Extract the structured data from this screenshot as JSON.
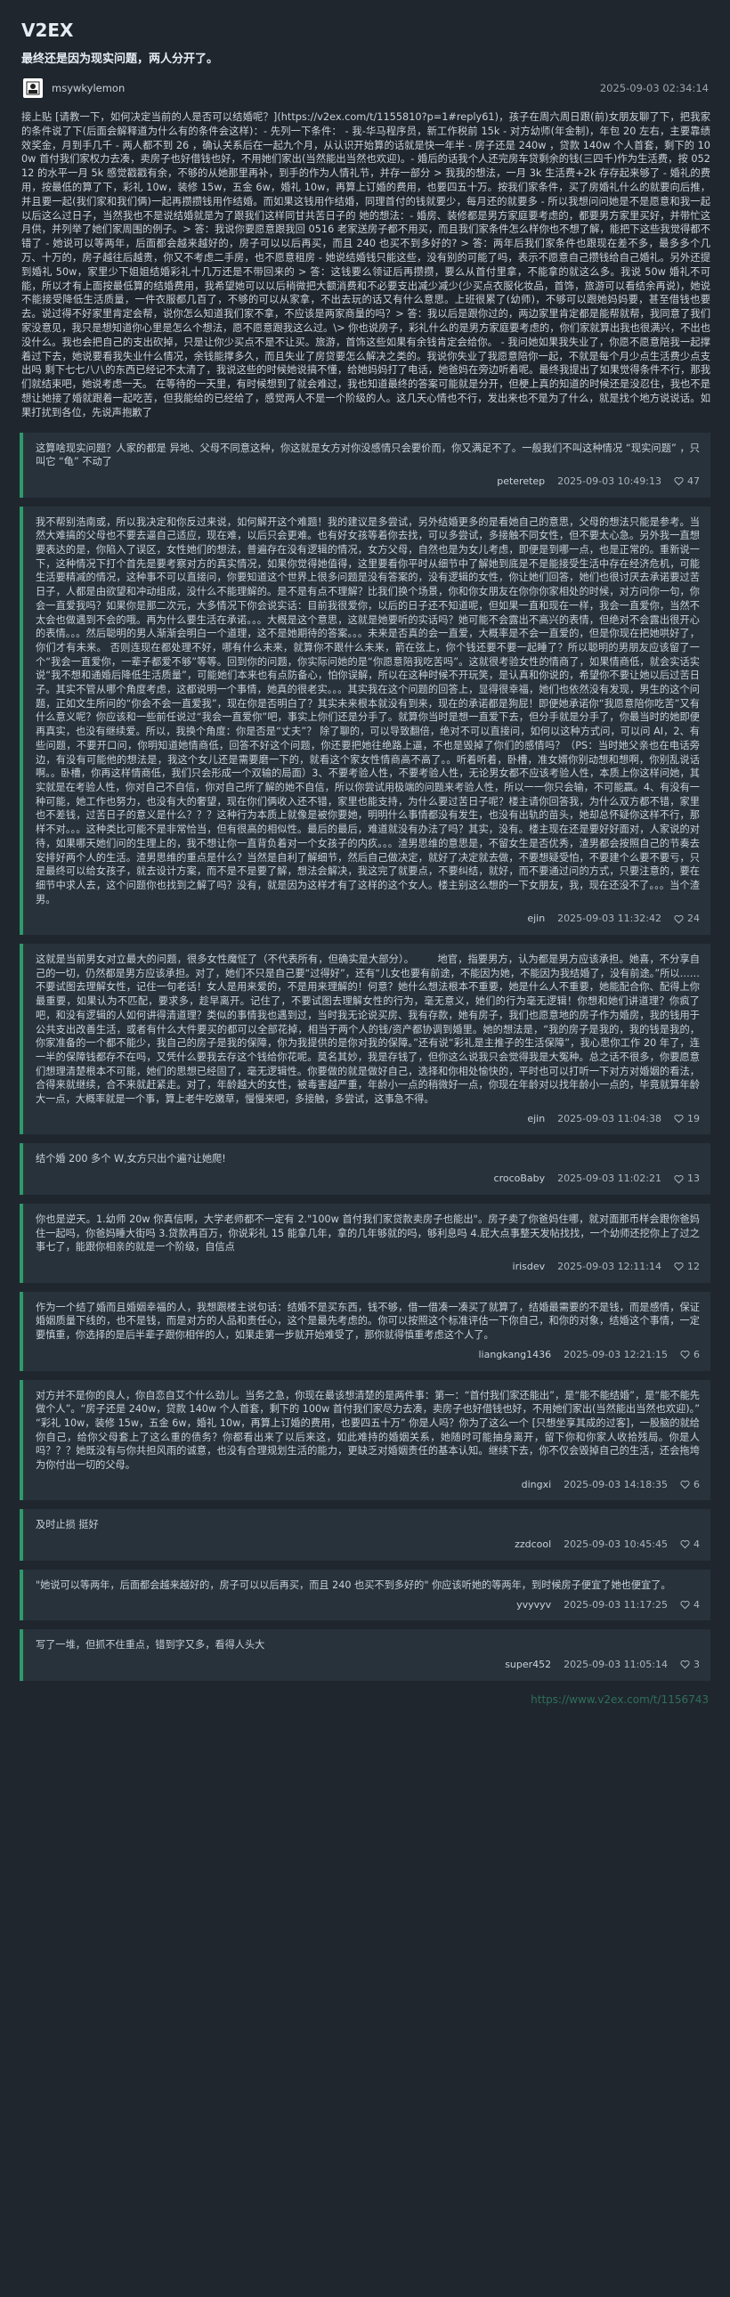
{
  "site": {
    "title": "V2EX"
  },
  "topic": {
    "title": "最终还是因为现实问题，两人分开了。",
    "author": "msywkylemon",
    "time": "2025-09-03 02:34:14",
    "content": "接上贴 [请教一下，如何决定当前的人是否可以结婚呢？](https://v2ex.com/t/1155810?p=1#reply61)，孩子在周六周日跟(前)女朋友聊了下，把我家的条件说了下(后面会解释道为什么有的条件会这样)：- 先列一下条件： - 我-华马程序员，新工作税前 15k - 对方幼师(年金制)，年包 20 左右，主要靠绩效奖金，月到手几千 - 两人都不到 26 ，确认关系后在一起九个月，从认识开始算的话就是快一年半 - 房子还是 240w ，贷款 140w 个人首套，剩下的 100w 首付我们家权力去凑，卖房子也好借钱也好，不用她们家出(当然能出当然也欢迎)。- 婚后的话我个人还完房车贷剩余的钱(三四千)作为生活费，按 05212 的水平一月 5k 感觉戳戳有余，不够的从她那里再补，到手的作为人情礼节，并存一部分 > 我我的想法，一月 3k 生活费+2k 存存起来够了 - 婚礼的费用，按最低的算了下，彩礼 10w，装修 15w，五金 6w，婚礼 10w，再算上订婚的费用，也要四五十万。按我们家条件，买了房婚礼什么的就要向后推，并且要一起(我们家和我们俩)一起再攒攒钱用作结婚。而如果这钱用作结婚，同理首付的钱就要少，每月还的就要多 - 所以我想问问她是不是愿意和我一起以后这么过日子，当然我也不是说结婚就是为了跟我们这样同甘共苦日子的 她的想法：- 婚房、装修都是男方家庭要考虑的，都要男方家里买好，并带忙这月供，并列举了她们家周围的例子。> 答：我说你要愿意跟我回 0516 老家送房子都不用买，而且我们家条件怎么样你也不想了解，能把下这些我觉得都不错了 - 她说可以等两年，后面都会越来越好的，房子可以以后再买，而且 240 也买不到多好的? > 答：两年后我们家条件也跟现在差不多，最多多个几万、十万的，房子越往后越贵，你又不考虑二手房，也不愿意租房 - 她说结婚钱只能这些，没有别的可能了吗，表示不愿意自己攒钱给自己婚礼。另外还提到婚礼 50w，家里少下姐姐结婚彩礼十几万还是不带回来的 > 答：这钱要么领证后再攒攒，要么从首付里拿，不能拿的就这么多。我说 50w 婚礼不可能，所以才有上面按最低算的结婚费用，我希望她可以以后稍微把大额消费和不必要支出减少减少(少买点衣服化妆品，首饰，旅游可以看结余再说)，她说不能接受降低生活质量，一件衣服都几百了，不够的可以从家拿，不出去玩的话又有什么意思。上班很累了(幼师)，不够可以跟她妈妈要，甚至借钱也要去。说过得不好家里肯定会帮，说你怎么知道我们家不拿，不应该是两家商量的吗？> 答：我以后是跟你过的，两边家里肯定都是能帮就帮，我同意了我们家没意见，我只是想知道你心里是怎么个想法，愿不愿意跟我这么过。\\> 你也说房子，彩礼什么的是男方家庭要考虑的，你们家就算出我也很满兴，不出也没什么。我也会把自己的支出砍掉，只是让你少买点不是不让买。旅游，首饰这些如果有余钱肯定会给你。 - 我问她如果我失业了，你愿不愿意陪我一起撑着过下去，她说要看我失业什么情况，余钱能撑多久，而且失业了房贷要怎么解决之类的。我说你失业了我愿意陪你一起，不就是每个月少点生活费少点支出吗 剩下七七八八的东西已经记不太清了，我说这些的时候她说搞不懂，给她妈妈打了电话，她爸妈在旁边听着呢。最终我提出了如果觉得条件不行，那我们就结束吧，她说考虑一天。 在等待的一天里，有时候想到了就会难过，我也知道最终的答案可能就是分开，但梗上真的知道的时候还是没忍住，我也不是想让她接了婚就跟着一起吃苦，但我能给的已经给了，感觉两人不是一个阶级的人。这几天心情也不行，发出来也不是为了什么，就是找个地方说说话。如果打扰到各位，先说声抱歉了"
  },
  "replies": [
    {
      "content": "这算啥现实问题？人家的都是 异地、父母不同意这种，你这就是女方对你没感情只会要价而，你又满足不了。一般我们不叫这种情况 “现实问题” ，只叫它 “龟” 不动了",
      "user": "peteretep",
      "time": "2025-09-03 10:49:13",
      "likes": "47"
    },
    {
      "content": "我不帮别浩南或，所以我决定和你反过来说，如何解开这个难题！我的建议是多尝试，另外结婚更多的是看她自己的意思，父母的想法只能是参考。当然大难搞的父母也不要去逼自己适应，现在难，以后只会更难。也有好女孩等着你去找，可以多尝试，多接触不同女性，但不要太心急。另外我一直想要表达的是，你陷入了误区，女性她们的想法，普遍存在没有逻辑的情况，女方父母，自然也是为女儿考虑，即便是到哪一点，也是正常的。重新说一下，这种情况下打个首先是要考察对方的真实情况，如果你觉得她值得，这里要看你平时从细节中了解她到底是不是能接受生活中存在经济危机，可能生活要精减的情况，这种事不可以直接问，你要知道这个世界上很多问题是没有答案的，没有逻辑的女性，你让她们回答，她们也很讨厌去承诺要过苦日子，人都是由欲望和冲动组成，没什么不能理解的。是不是有点不理解？比我们换个场景，你和你女朋友在你你你家相处的时候，对方问你一句，你会一直爱我吗？如果你是那二次元，大多情况下你会说实话：目前我很爱你，以后的日子还不知道呢，但如果一直和现在一样，我会一直爱你，当然不太会也做遇到不会的哦。再为什么要生活在承诺。。。大概是这个意思，这就是她要听的实话吗？她可能不会露出不高兴的表情，但绝对不会露出很开心的表情。。。然后聪明的男人渐渐会明白一个道理，这不是她期待的答案。。。未来是否真的会一直爱，大概率是不会一直爱的，但是你现在把她哄好了，你们才有未来。 否则连现在都处理不好，哪有什么未来，就算你不跟什么未来，箭在弦上，你个钱还要不要一起睡了？所以聪明的男朋友应该留了一个“我会一直爱你，一辈子都爱不够”等等。回到你的问题，你实际问她的是“你愿意陪我吃苦吗”。这就很考验女性的情商了，如果情商低，就会实话实说“我不想和通婚后降低生活质量”，可能她们本来也有点防备心，怕你误解，所以在这种时候不开玩笑，是认真和你说的，希望你不要让她以后过苦日子。其实不管从哪个角度考虑，这都说明一个事情，她真的很老实。。。其实我在这个问题的回答上，显得很幸福，她们也依然没有发现，男生的这个问题，正如文生所问的“你会不会一直爱我”，现在你是否明白了？其实未来根本就没有到来，现在的承诺都是狗屁！即便她承诺你“我愿意陪你吃苦”又有什么意义呢？你应该和一些前任说过“我会一直爱你”吧，事实上你们还是分手了。就算你当时是想一直爱下去，但分手就是分手了，你最当时的她即便再真实，也没有继续爱。所以，我换个角度：你是否是“丈夫”？ 除了聊的，可以导致翻倍，绝对不可以直接问，如何以这种方式问，可以问 AI，2、有些问题，不要开口问，你明知道她情商低，回答不好这个问题，你还要把她往绝路上逼，不也是毁掉了你们的感情吗？（PS：当时她父亲也在电话旁边，有没有可能他的想法是，我这个女儿还是需要磨一下的，就看这个家女性情商高不高了。。听着听着，卧槽，准女婿你别动想和想啊，你别乱说话啊。。卧槽，你再这样情商低，我们只会形成一个双输的局面）3、不要考验人性，不要考验人性，无论男女都不应该考验人性，本质上你这样问她，其实就是在考验人性，你对自己不自信，你对自己所了解的她不自信，所以你尝试用极端的问题来考验人性，所以一一你只会输，不可能赢。4、有没有一种可能，她工作也努力，也没有大的奢望，现在你们俩收入还不错，家里也能支持，为什么要过苦日子呢？楼主请你回答我，为什么双方都不错，家里也不差钱，过苦日子的意义是什么？？？这种行为本质上就像是被你要她，明明什么事情都没有发生，也没有出轨的苗头，她却总怀疑你这样不行，那样不对。。。这种类比可能不是非常恰当，但有很高的相似性。最后的最后，难道就没有办法了吗？其实，没有。楼主现在还是要好好面对，人家说的对待，如果哪天她们问的生理上的，我不想让你一直背负着对一个女孩子的内疚。。。渣男思维的意思是，不留女生是否优秀，渣男都会按照自己的节奏去安排好两个人的生活。渣男思维的重点是什么？当然是自利了解细节，然后自己做决定，就好了决定就去做，不要想疑受怕，不要建个么要不要亏，只是最终可以给女孩子，就去设计方案，而不是不是要了解，想法会解决，我这完了就要点，不要纠结，就好，而不要通过问的方式，只要注意的，要在细节中求人去，这个问题你也找到之解了吗？没有，就是因为这样才有了这样的这个女人。楼主别这么想的一下女朋友，我，现在还没不了。。。当个渣男。",
      "user": "ejin",
      "time": "2025-09-03 11:32:42",
      "likes": "24"
    },
    {
      "content": "这就是当前男女对立最大的问题，很多女性魔怔了（不代表所有，但确实是大部分）。 　　地官，指要男方，认为都是男方应该承担。她喜，不分享自己的一切，仍然都是男方应该承担。对了，她们不只是自己要“过得好”，还有“儿女也要有前途，不能因为她，不能因为我结婚了，没有前途。”所以……不要试图去理解女性，记住一句老话！女人是用来爱的，不是用来理解的！何意？她什么想法根本不重要，她是什么人不重要，她能配合你、配得上你最重要，如果认为不匹配，要求多，趁早离开。记住了，不要试图去理解女性的行为，毫无意义，她们的行为毫无逻辑！你想和她们讲道理？你疯了吧，和没有逻辑的人如何讲得清道理？类似的事情我也遇到过，当时我无论说买房、我有存款，她有房子，我们也愿意地的房子作为婚房，我的钱用于公共支出改善生活，或者有什么大件要买的都可以全部花掉，相当于两个人的钱/资产都协调到婚里。她的想法是，“我的房子是我的，我的钱是我的，你家准备的一个都不能少，我自己的房子是我的保障，你为我提供的是你对我的保障。”还有说“彩礼是主推子的生活保障”，我心思你工作 20 年了，连一半的保障钱都存不在吗，又凭什么要我去存这个钱给你花呢。莫名其妙，我是存钱了，但你这么说我只会觉得我是大冤种。总之话不很多，你要愿意们想理清楚根本不可能，她们的思想已经固了，毫无逻辑性。你要做的就是做好自己，选择和你相处愉快的，平时也可以打听一下对方对婚姻的看法，合得来就继续，合不来就赶紧走。对了，年龄越大的女性，被毒害越严重，年龄小一点的稍微好一点，你现在年龄对以找年龄小一点的，毕竟就算年龄大一点，大概率就是一个事，算上老牛吃嫩草，慢慢来吧，多接触，多尝试，这事急不得。",
      "user": "ejin",
      "time": "2025-09-03 11:04:38",
      "likes": "19"
    },
    {
      "content": "结个婚 200 多个 W,女方只出个遍?让她爬!",
      "user": "crocoBaby",
      "time": "2025-09-03 11:02:21",
      "likes": "13"
    },
    {
      "content": "你也是逆天。1.幼师 20w 你真信啊，大学老师都不一定有 2.\"100w 首付我们家贷款卖房子也能出\"。房子卖了你爸妈住哪，就对面那币样会跟你爸妈住一起吗，你爸妈睡大街吗 3.贷款再百万，你说彩礼 15 能拿几年，拿的几年够就的吗，够利息吗 4.屁大点事整天发帖找找，一个幼师还挖你上了过之事七了，能跟你相亲的就是一个阶级，自信点",
      "user": "irisdev",
      "time": "2025-09-03 12:11:14",
      "likes": "12"
    },
    {
      "content": "作为一个结了婚而且婚姻幸福的人，我想跟楼主说句话：结婚不是买东西，钱不够，借一借凑一凑买了就算了，结婚最需要的不是钱，而是感情，保证婚姻质量下线的，也不是钱，而是对方的人品和责任心，这个是最先考虑的。你可以按照这个标准评估一下你自己，和你的对象，结婚这个事情，一定要慎重，你选择的是后半辈子跟你相伴的人，如果走第一步就开始难受了，那你就得慎重考虑这个人了。",
      "user": "liangkang1436",
      "time": "2025-09-03 12:21:15",
      "likes": "6"
    },
    {
      "content": "对方并不是你的良人，你自恋自艾个什么劲儿。当务之急，你现在最该想清楚的是两件事：第一：“首付我们家还能出”，是“能不能结婚”，是“能不能先做个人”。“房子还是 240w，贷款 140w 个人首套，剩下的 100w 首付我们家尽力去凑，卖房子也好借钱也好，不用她们家出(当然能出当然也欢迎)。” “彩礼 10w，装修 15w，五金 6w，婚礼 10w，再算上订婚的费用，也要四五十万” 你是人吗？你为了这么一个 [只想坐享其成的过客]，一股脑的就给你自己，给你父母套上了这么重的债务？你都看出来了以后来这，如此难持的婚姻关系，她随时可能抽身离开，留下你和你家人收拾残局。你是人吗？？？她既没有与你共担风雨的诚意，也没有合理规划生活的能力，更缺乏对婚姻责任的基本认知。继续下去，你不仅会毁掉自己的生活，还会拖垮为你付出一切的父母。",
      "user": "dingxi",
      "time": "2025-09-03 14:18:35",
      "likes": "6"
    },
    {
      "content": "及时止损 挺好",
      "user": "zzdcool",
      "time": "2025-09-03 10:45:45",
      "likes": "4"
    },
    {
      "content": "\"她说可以等两年，后面都会越来越好的，房子可以以后再买，而且 240 也买不到多好的\" 你应该听她的等两年，到时候房子便宜了她也便宜了。",
      "user": "yvyvyv",
      "time": "2025-09-03 11:17:25",
      "likes": "4"
    },
    {
      "content": "写了一堆，但抓不住重点，错到字又多，看得人头大",
      "user": "super452",
      "time": "2025-09-03 11:05:14",
      "likes": "3"
    }
  ],
  "footer": {
    "url": "https://www.v2ex.com/t/1156743"
  },
  "colors": {
    "background": "#1f262e",
    "reply_bg": "#28323b",
    "accent": "#2d9a6a"
  },
  "icons": {
    "avatar": "avatar-icon",
    "like": "heart-icon"
  }
}
